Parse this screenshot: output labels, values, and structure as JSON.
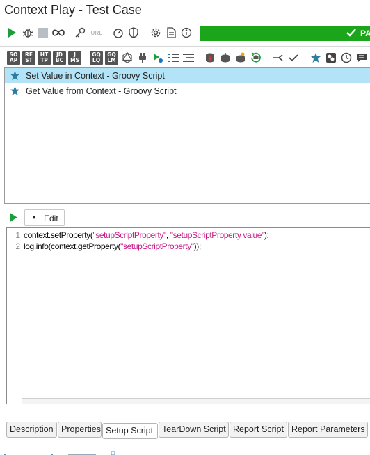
{
  "window": {
    "title": "Context Play - Test Case"
  },
  "toolbar": {
    "icons": [
      "run-icon",
      "debug-bug-icon",
      "stop-icon",
      "loop-icon",
      "key-icon",
      "url-icon",
      "gauge-icon",
      "shield-icon",
      "gear-icon",
      "document-icon",
      "info-icon"
    ],
    "url_label": "URL",
    "status_text": "PA",
    "status_color": "#1aa51a"
  },
  "step_toolbar": {
    "badges": [
      [
        "SO",
        "AP"
      ],
      [
        "RE",
        "ST"
      ],
      [
        "HT",
        "TP"
      ],
      [
        "JD",
        "BC"
      ],
      [
        "J",
        "MS"
      ],
      [
        "GQ",
        "LQ"
      ],
      [
        "GQ",
        "LM"
      ]
    ],
    "icons": [
      "graphql-icon",
      "plug-icon",
      "run-step-icon",
      "list-icon",
      "indent-icon",
      "database-in-icon",
      "database-out-icon",
      "database-star-icon",
      "database-refresh-icon",
      "branch-icon",
      "check-icon",
      "star-icon",
      "puzzle-icon",
      "clock-icon",
      "comment-icon"
    ]
  },
  "steps": [
    {
      "label": "Set Value in Context - Groovy Script",
      "selected": true
    },
    {
      "label": "Get Value from Context - Groovy Script",
      "selected": false
    }
  ],
  "editor": {
    "edit_label": "Edit",
    "lines": [
      {
        "num": "1",
        "pre": "context.setProperty(",
        "s1": "\"setupScriptProperty\"",
        "mid": ", ",
        "s2": "\"setupScriptProperty value\"",
        "post": ");"
      },
      {
        "num": "2",
        "pre": "log.info(context.getProperty(",
        "s1": "\"setupScriptProperty\"",
        "mid": "",
        "s2": "",
        "post": "));"
      }
    ],
    "string_color": "#c71585"
  },
  "tabs": [
    {
      "label": "Description",
      "active": false
    },
    {
      "label": "Properties",
      "active": false
    },
    {
      "label": "Setup Script",
      "active": true
    },
    {
      "label": "TearDown Script",
      "active": false
    },
    {
      "label": "Report Script",
      "active": false
    },
    {
      "label": "Report Parameters",
      "active": false
    }
  ]
}
